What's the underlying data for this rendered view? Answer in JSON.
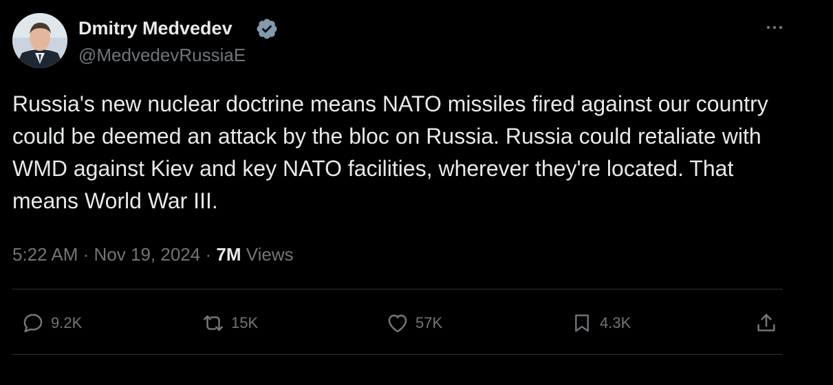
{
  "author": {
    "display_name": "Dmitry Medvedev",
    "handle": "@MedvedevRussiaE",
    "verified": true
  },
  "tweet": {
    "text": "Russia's new nuclear doctrine means NATO missiles fired against our country could be deemed an attack by the bloc on Russia. Russia could retaliate with WMD against Kiev and key NATO facilities, wherever they're located. That means World War III.",
    "time": "5:22 AM",
    "separator": "·",
    "date": "Nov 19, 2024",
    "views_count": "7M",
    "views_label": "Views"
  },
  "actions": {
    "reply": {
      "count": "9.2K",
      "icon": "reply-icon"
    },
    "retweet": {
      "count": "15K",
      "icon": "retweet-icon"
    },
    "like": {
      "count": "57K",
      "icon": "heart-icon"
    },
    "bookmark": {
      "count": "4.3K",
      "icon": "bookmark-icon"
    },
    "share": {
      "icon": "share-icon"
    }
  },
  "colors": {
    "background": "#000000",
    "primary_text": "#e7e9ea",
    "secondary_text": "#71767b",
    "divider": "#2f3336",
    "verified_badge": "#829aab"
  }
}
